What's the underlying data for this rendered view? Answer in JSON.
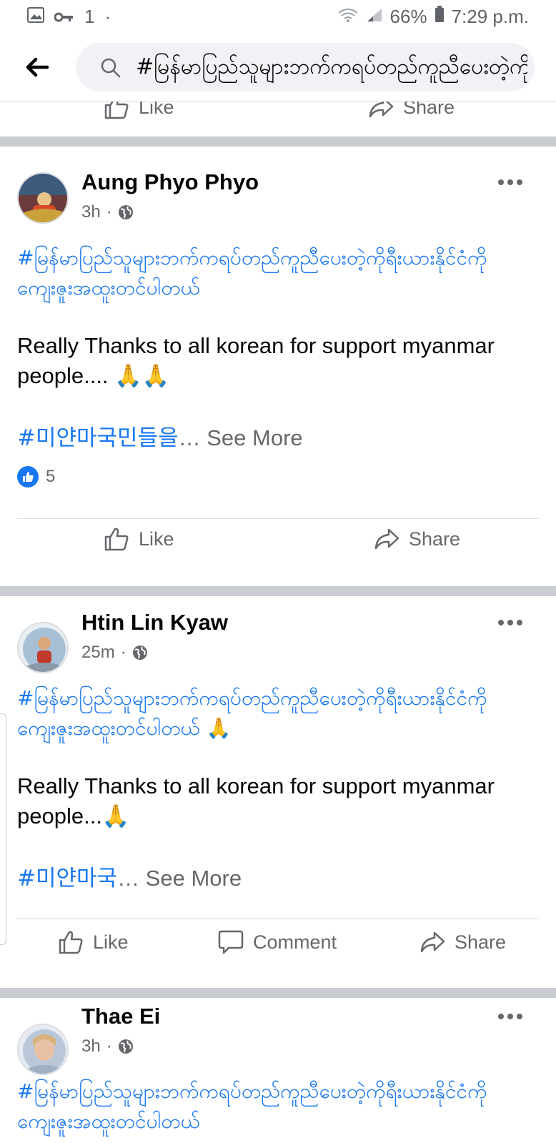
{
  "status_bar": {
    "notif_count": "1",
    "battery": "66%",
    "time": "7:29 p.m."
  },
  "search": {
    "query": "#မြန်မာပြည်သူများဘက်ကရပ်တည်ကူညီပေးတဲ့ကိုရီးယားနိုင်ငံကိုကျေးဇူးအထူးတင်ပါတယ်"
  },
  "previous_post": {
    "like_label": "Like",
    "share_label": "Share"
  },
  "posts": [
    {
      "author": "Aung Phyo Phyo",
      "time": "3h",
      "hashtag_mm": "#မြန်မာပြည်သူများဘက်ကရပ်တည်ကူညီပေးတဲ့ကိုရီးယားနိုင်ငံကိုကျေးဇူးအထူးတင်ပါတယ်",
      "hashtag_mm_suffix": "",
      "body": "Really Thanks to all korean for support myanmar people.... 🙏🙏",
      "hashtag_kr": "#미얀마국민들을",
      "see_more": "… See More",
      "reaction_count": "5",
      "actions": {
        "like": "Like",
        "share": "Share"
      }
    },
    {
      "author": "Htin Lin Kyaw",
      "time": "25m",
      "hashtag_mm": "#မြန်မာပြည်သူများဘက်ကရပ်တည်ကူညီပေးတဲ့ကိုရီးယားနိုင်ငံကိုကျေးဇူးအထူးတင်ပါတယ်",
      "hashtag_mm_suffix": " 🙏",
      "body": "Really Thanks to all korean for support myanmar people...🙏",
      "hashtag_kr": "#미얀마국",
      "see_more": "… See More",
      "actions": {
        "like": "Like",
        "comment": "Comment",
        "share": "Share"
      }
    },
    {
      "author": "Thae Ei",
      "time": "3h",
      "hashtag_mm": "#မြန်မာပြည်သူများဘက်ကရပ်တည်ကူညီပေးတဲ့ကိုရီးယားနိုင်ငံကိုကျေးဇူးအထူးတင်ပါတယ်",
      "hashtag_mm_suffix": ""
    }
  ],
  "colors": {
    "link": "#1877f2",
    "secondary_text": "#65676b",
    "divider": "#c9ccd1",
    "search_bg": "#f0f2f5"
  }
}
